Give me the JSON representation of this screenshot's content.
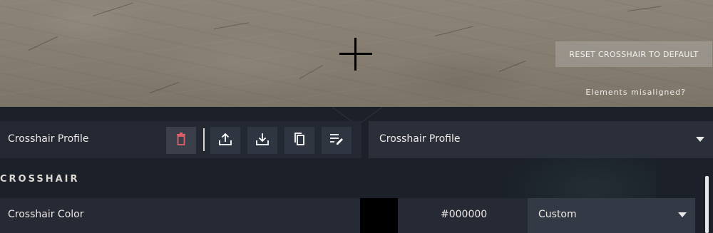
{
  "preview": {
    "reset_label": "RESET CROSSHAIR TO DEFAULT",
    "misaligned_label": "Elements misaligned?"
  },
  "profile": {
    "label": "Crosshair Profile",
    "selected": "Crosshair Profile",
    "icons": [
      "trash-icon",
      "upload-icon",
      "download-icon",
      "copy-icon",
      "edit-list-icon"
    ],
    "delete_color": "#e0606a"
  },
  "section": {
    "title": "CROSSHAIR"
  },
  "crosshair_color": {
    "label": "Crosshair Color",
    "swatch_color": "#000000",
    "hex": "#000000",
    "mode": "Custom"
  }
}
